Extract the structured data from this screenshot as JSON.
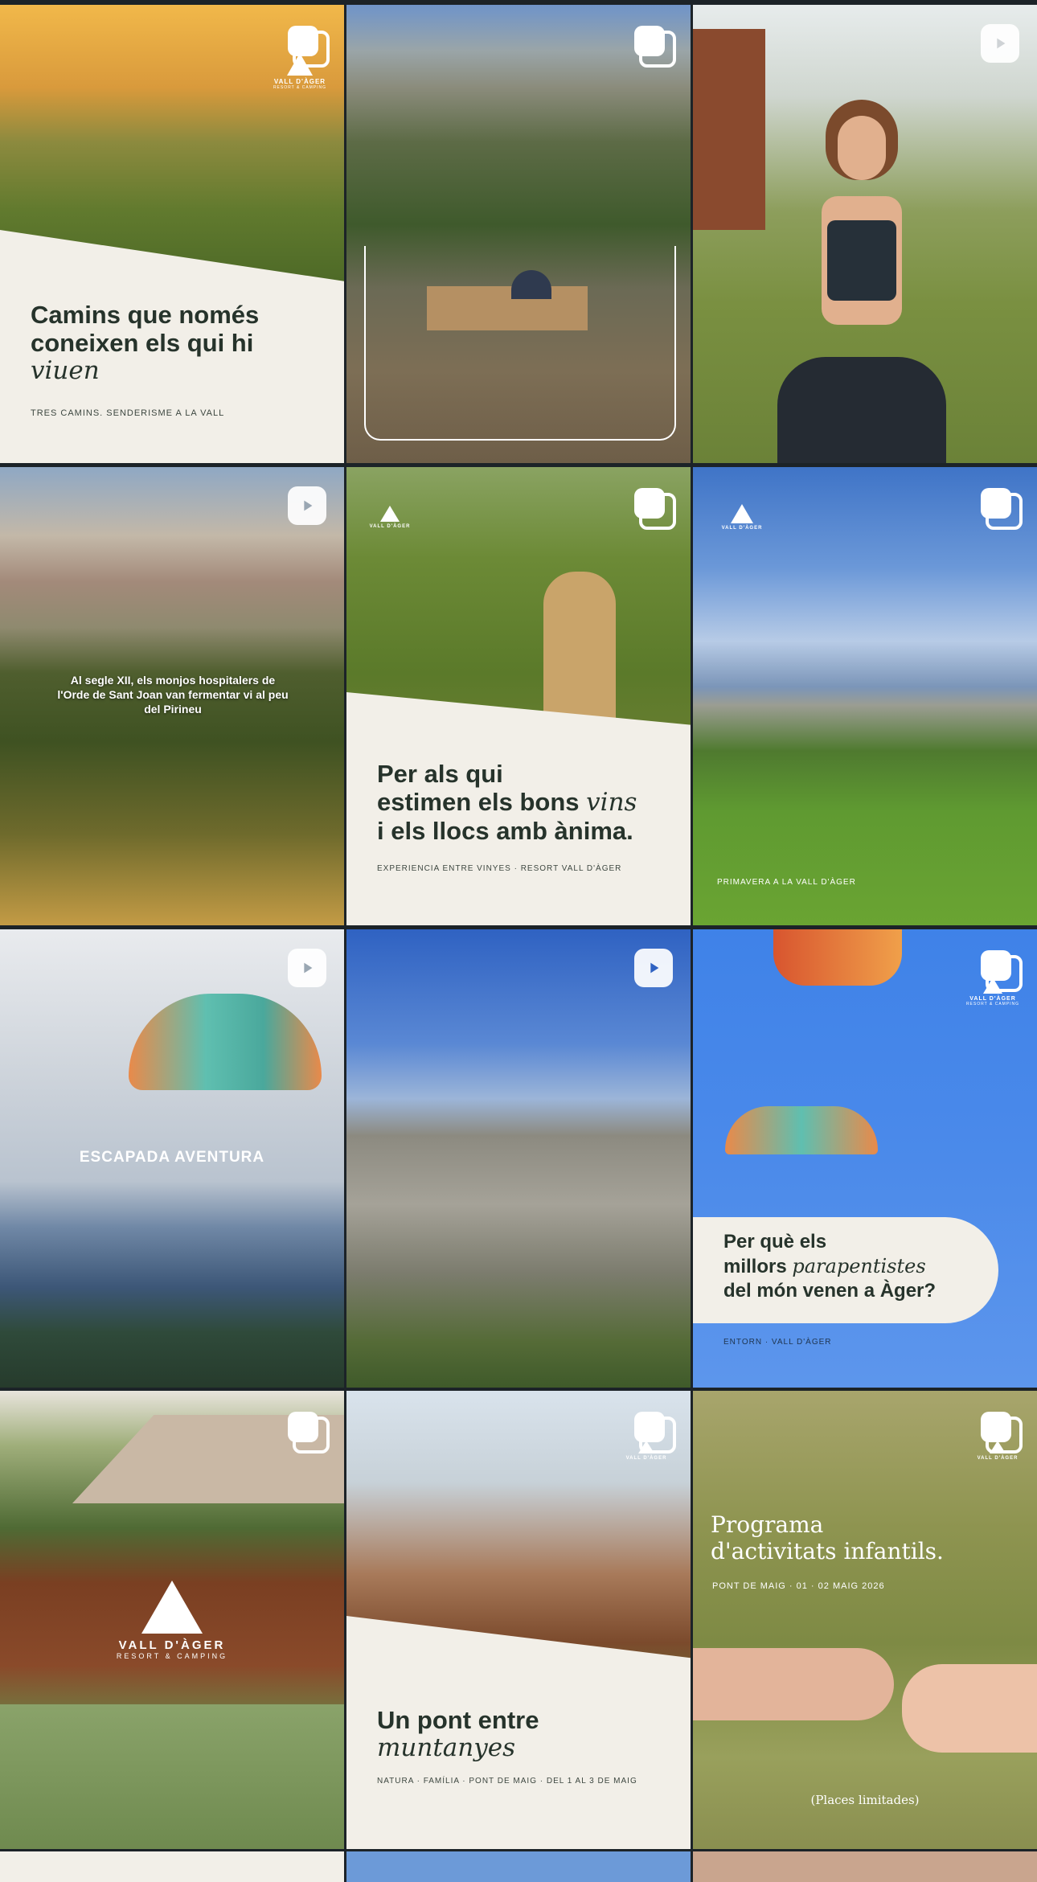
{
  "tiles": {
    "t1": {
      "heading_line1": "Camins que només",
      "heading_line2": "coneixen els qui hi",
      "heading_italic": "viuen",
      "caption": "TRES CAMINS. SENDERISME A LA VALL",
      "logo_name": "VALL D'ÀGER",
      "logo_sub": "RESORT & CAMPING"
    },
    "t4": {
      "overlay": "Al segle XII, els monjos hospitalers de l'Orde de Sant Joan van fermentar vi al peu del Pirineu"
    },
    "t5": {
      "heading_line1": "Per als qui",
      "heading_line2a": "estimen els bons",
      "heading_italic": "vins",
      "heading_line3": "i els llocs amb ànima.",
      "caption": "EXPERIENCIA ENTRE VINYES ·  RESORT VALL D'ÀGER",
      "logo_name": "VALL D'ÀGER"
    },
    "t6": {
      "caption": "PRIMAVERA A LA VALL D'ÀGER",
      "logo_name": "VALL D'ÀGER"
    },
    "t7": {
      "overlay": "ESCAPADA AVENTURA"
    },
    "t9": {
      "heading_line1": "Per què els",
      "heading_line2a": "millors",
      "heading_italic": "parapentistes",
      "heading_line3": "del món venen a Àger?",
      "caption": "ENTORN · VALL D'ÀGER",
      "logo_name": "VALL D'ÀGER",
      "logo_sub": "RESORT & CAMPING"
    },
    "t10": {
      "logo_name": "VALL D'ÀGER",
      "logo_sub": "RESORT & CAMPING"
    },
    "t11": {
      "heading_line1": "Un pont entre",
      "heading_italic": "muntanyes",
      "caption": "NATURA · FAMÍLIA · PONT DE MAIG · DEL 1 AL 3 DE MAIG",
      "logo_name": "VALL D'ÀGER"
    },
    "t12": {
      "heading_line1": "Programa",
      "heading_line2": "d'activitats infantils.",
      "caption": "PONT DE MAIG · 01 · 02 MAIG  2026",
      "footer": "(Places limitades)",
      "logo_name": "VALL D'ÀGER"
    }
  },
  "colors": {
    "cream": "#f2efe8",
    "heading": "#26332b",
    "grid_bg": "#1c2328"
  },
  "icons": [
    "reel-icon",
    "carousel-icon"
  ]
}
